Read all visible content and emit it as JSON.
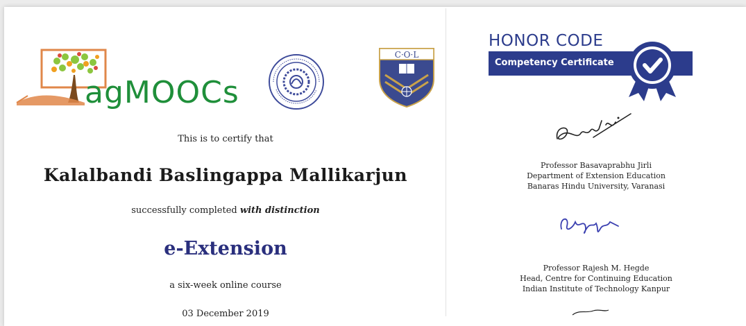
{
  "logos": {
    "agmoocs_text": "agMOOCs",
    "iitk_seal": "INDIAN INSTITUTE OF TECHNOLOGY KANPUR",
    "col_text": "C·O·L"
  },
  "certificate": {
    "certify_text": "This is to certify that",
    "recipient_name": "Kalalbandi Baslingappa Mallikarjun",
    "completed_text": "successfully completed",
    "distinction_text": "with distinction",
    "course_name": "e-Extension",
    "course_duration": "a six-week online course",
    "date": "03 December 2019"
  },
  "honor_code": {
    "title": "HONOR CODE",
    "banner_label": "Competency Certificate",
    "accent_color": "#2c3c8c"
  },
  "signatories": [
    {
      "name": "Professor Basavaprabhu Jirli",
      "line2": "Department of Extension Education",
      "line3": "Banaras Hindu University, Varanasi"
    },
    {
      "name": "Professor Rajesh M. Hegde",
      "line2": "Head, Centre for Continuing Education",
      "line3": "Indian Institute of Technology Kanpur"
    }
  ],
  "colors": {
    "name_text": "#1b1b1b",
    "course_text": "#2a2f7d",
    "agmoocs_green": "#1f8f3a",
    "col_shield_blue": "#3b4a8f",
    "col_shield_gold": "#c9a24a",
    "signature_blue": "#3a3fb0"
  }
}
